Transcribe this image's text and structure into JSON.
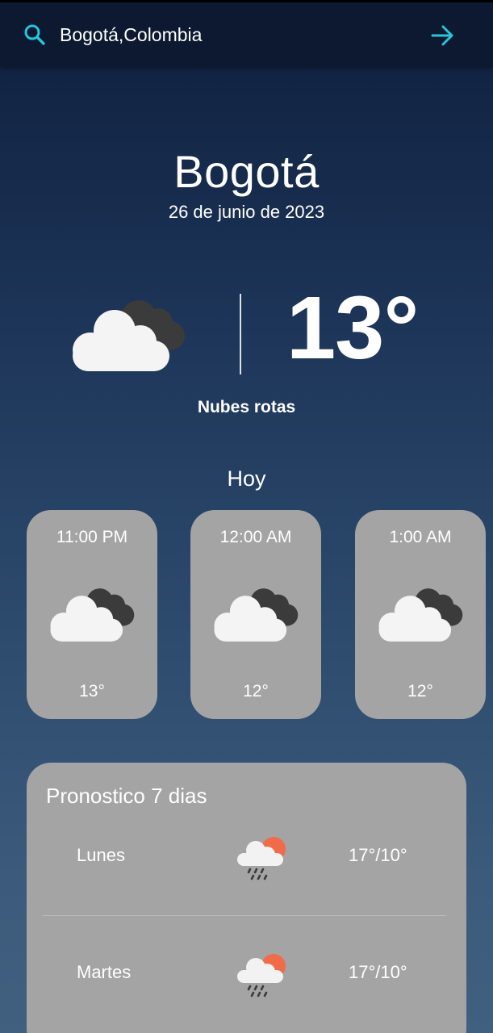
{
  "search": {
    "value": "Bogotá,Colombia",
    "icon": "search-icon",
    "submit_icon": "arrow-right-icon",
    "accent_color": "#26c6da"
  },
  "current": {
    "city": "Bogotá",
    "date": "26 de junio de 2023",
    "temperature": "13°",
    "condition": "Nubes rotas",
    "icon": "broken-clouds-icon"
  },
  "today": {
    "title": "Hoy",
    "hours": [
      {
        "time": "11:00 PM",
        "temp": "13°",
        "icon": "broken-clouds-icon"
      },
      {
        "time": "12:00 AM",
        "temp": "12°",
        "icon": "broken-clouds-icon"
      },
      {
        "time": "1:00 AM",
        "temp": "12°",
        "icon": "broken-clouds-icon"
      }
    ]
  },
  "forecast": {
    "title": "Pronostico 7 dias",
    "days": [
      {
        "day": "Lunes",
        "temp": "17°/10°",
        "icon": "sun-rain-cloud-icon"
      },
      {
        "day": "Martes",
        "temp": "17°/10°",
        "icon": "sun-rain-cloud-icon"
      }
    ]
  }
}
